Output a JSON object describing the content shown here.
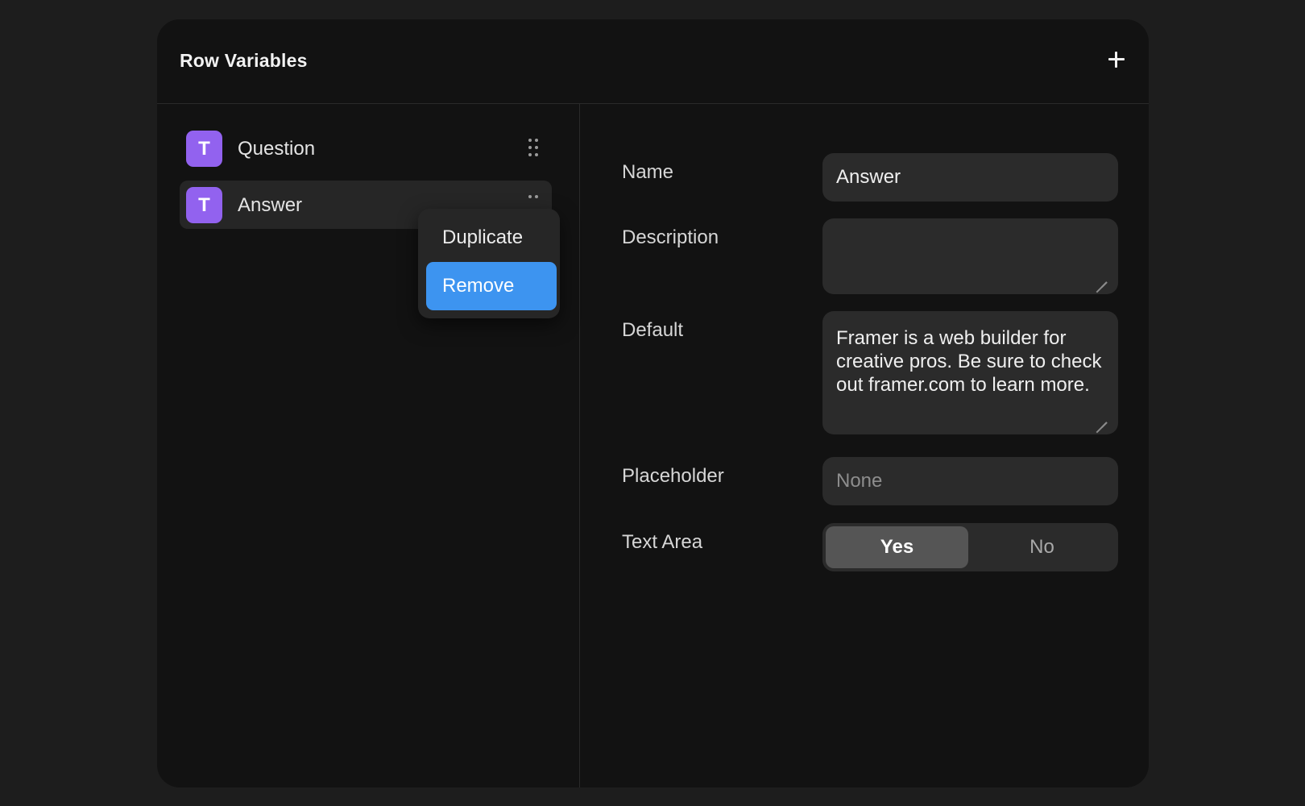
{
  "header": {
    "title": "Row Variables",
    "add_icon": "plus-icon"
  },
  "variables": [
    {
      "type_glyph": "T",
      "label": "Question",
      "icon_color": "#9262ef",
      "selected": false
    },
    {
      "type_glyph": "T",
      "label": "Answer",
      "icon_color": "#9262ef",
      "selected": true
    }
  ],
  "context_menu": {
    "items": [
      {
        "label": "Duplicate",
        "active": false
      },
      {
        "label": "Remove",
        "active": true
      }
    ],
    "active_color": "#3d94f0"
  },
  "form": {
    "name": {
      "label": "Name",
      "value": "Answer"
    },
    "description": {
      "label": "Description",
      "value": ""
    },
    "default": {
      "label": "Default",
      "value": "Framer is a web builder for creative pros. Be sure to check out framer.com to learn more."
    },
    "placeholder": {
      "label": "Placeholder",
      "placeholder": "None"
    },
    "text_area": {
      "label": "Text Area",
      "options": [
        "Yes",
        "No"
      ],
      "selected": "Yes"
    }
  }
}
